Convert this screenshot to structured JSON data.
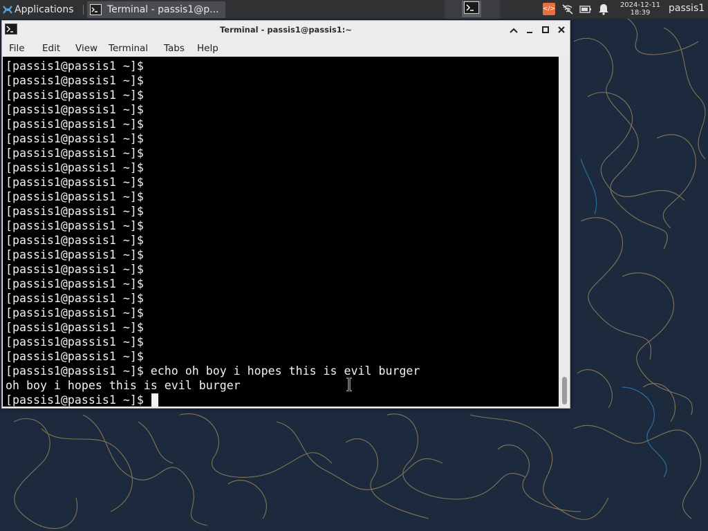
{
  "panel": {
    "applications_label": "Applications",
    "task_label": "Terminal - passis1@p...",
    "clock_date": "2024-12-11",
    "clock_time": "18:39",
    "user": "passis1",
    "icons": [
      "xfce-logo-icon",
      "terminal-icon",
      "workspace-terminal-icon",
      "orange-indicator-icon",
      "network-off-icon",
      "battery-icon",
      "notification-bell-icon"
    ]
  },
  "window": {
    "title": "Terminal - passis1@passis1:~",
    "controls": [
      "chevron-up-icon",
      "minimize-icon",
      "maximize-icon",
      "close-icon"
    ]
  },
  "menu": {
    "file": "File",
    "edit": "Edit",
    "view": "View",
    "terminal": "Terminal",
    "tabs": "Tabs",
    "help": "Help"
  },
  "terminal": {
    "lines": [
      "[passis1@passis1 ~]$",
      "[passis1@passis1 ~]$",
      "[passis1@passis1 ~]$",
      "[passis1@passis1 ~]$",
      "[passis1@passis1 ~]$",
      "[passis1@passis1 ~]$",
      "[passis1@passis1 ~]$",
      "[passis1@passis1 ~]$",
      "[passis1@passis1 ~]$",
      "[passis1@passis1 ~]$",
      "[passis1@passis1 ~]$",
      "[passis1@passis1 ~]$",
      "[passis1@passis1 ~]$",
      "[passis1@passis1 ~]$",
      "[passis1@passis1 ~]$",
      "[passis1@passis1 ~]$",
      "[passis1@passis1 ~]$",
      "[passis1@passis1 ~]$",
      "[passis1@passis1 ~]$",
      "[passis1@passis1 ~]$",
      "[passis1@passis1 ~]$",
      "[passis1@passis1 ~]$ echo oh boy i hopes this is evil burger",
      "oh boy i hopes this is evil burger"
    ],
    "prompt": "[passis1@passis1 ~]$ "
  },
  "colors": {
    "panel_bg": "#2f3133",
    "window_bg": "#ececec",
    "terminal_bg": "#000000",
    "terminal_fg": "#f2f2f2",
    "desktop_bg": "#1d2a3d",
    "desktop_lines": "#b59a6a",
    "accent_orange": "#e9703e"
  }
}
